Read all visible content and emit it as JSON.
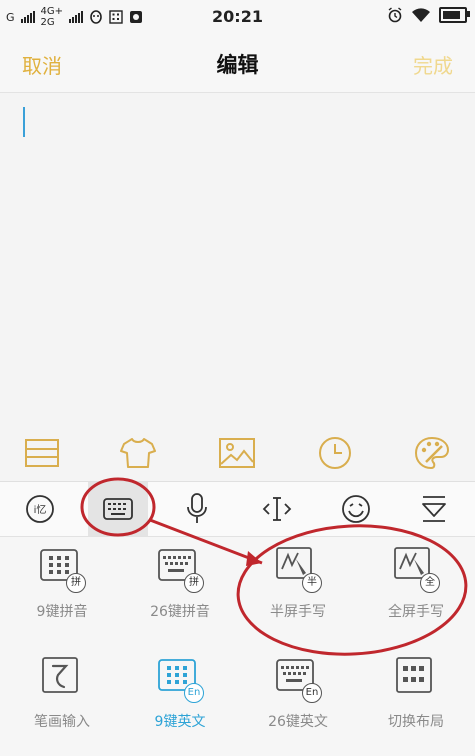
{
  "status_bar": {
    "carrier1": "G",
    "network_top": "4G+",
    "network_bottom": "2G",
    "time": "20:21",
    "battery_level": 0.85
  },
  "nav": {
    "cancel_label": "取消",
    "title": "编辑",
    "done_label": "完成",
    "accent_color": "#e0b13e"
  },
  "format_toolbar": {
    "icons": [
      "list-icon",
      "shirt-icon",
      "image-icon",
      "clock-icon",
      "palette-icon"
    ]
  },
  "ime_toolbar": {
    "icons": [
      "input-method-icon",
      "keyboard-icon",
      "microphone-icon",
      "cursor-move-icon",
      "emoji-icon",
      "hide-keyboard-icon"
    ],
    "active_index": 1
  },
  "input_modes": [
    {
      "label": "9键拼音",
      "badge": "拼"
    },
    {
      "label": "26键拼音",
      "badge": "拼"
    },
    {
      "label": "半屏手写",
      "badge": "半"
    },
    {
      "label": "全屏手写",
      "badge": "全"
    },
    {
      "label": "笔画输入",
      "badge": ""
    },
    {
      "label": "9键英文",
      "badge": "En"
    },
    {
      "label": "26键英文",
      "badge": "En"
    },
    {
      "label": "切换布局",
      "badge": ""
    }
  ],
  "selected_mode_color": "#2da3d6",
  "annotation_color": "#c0272d"
}
